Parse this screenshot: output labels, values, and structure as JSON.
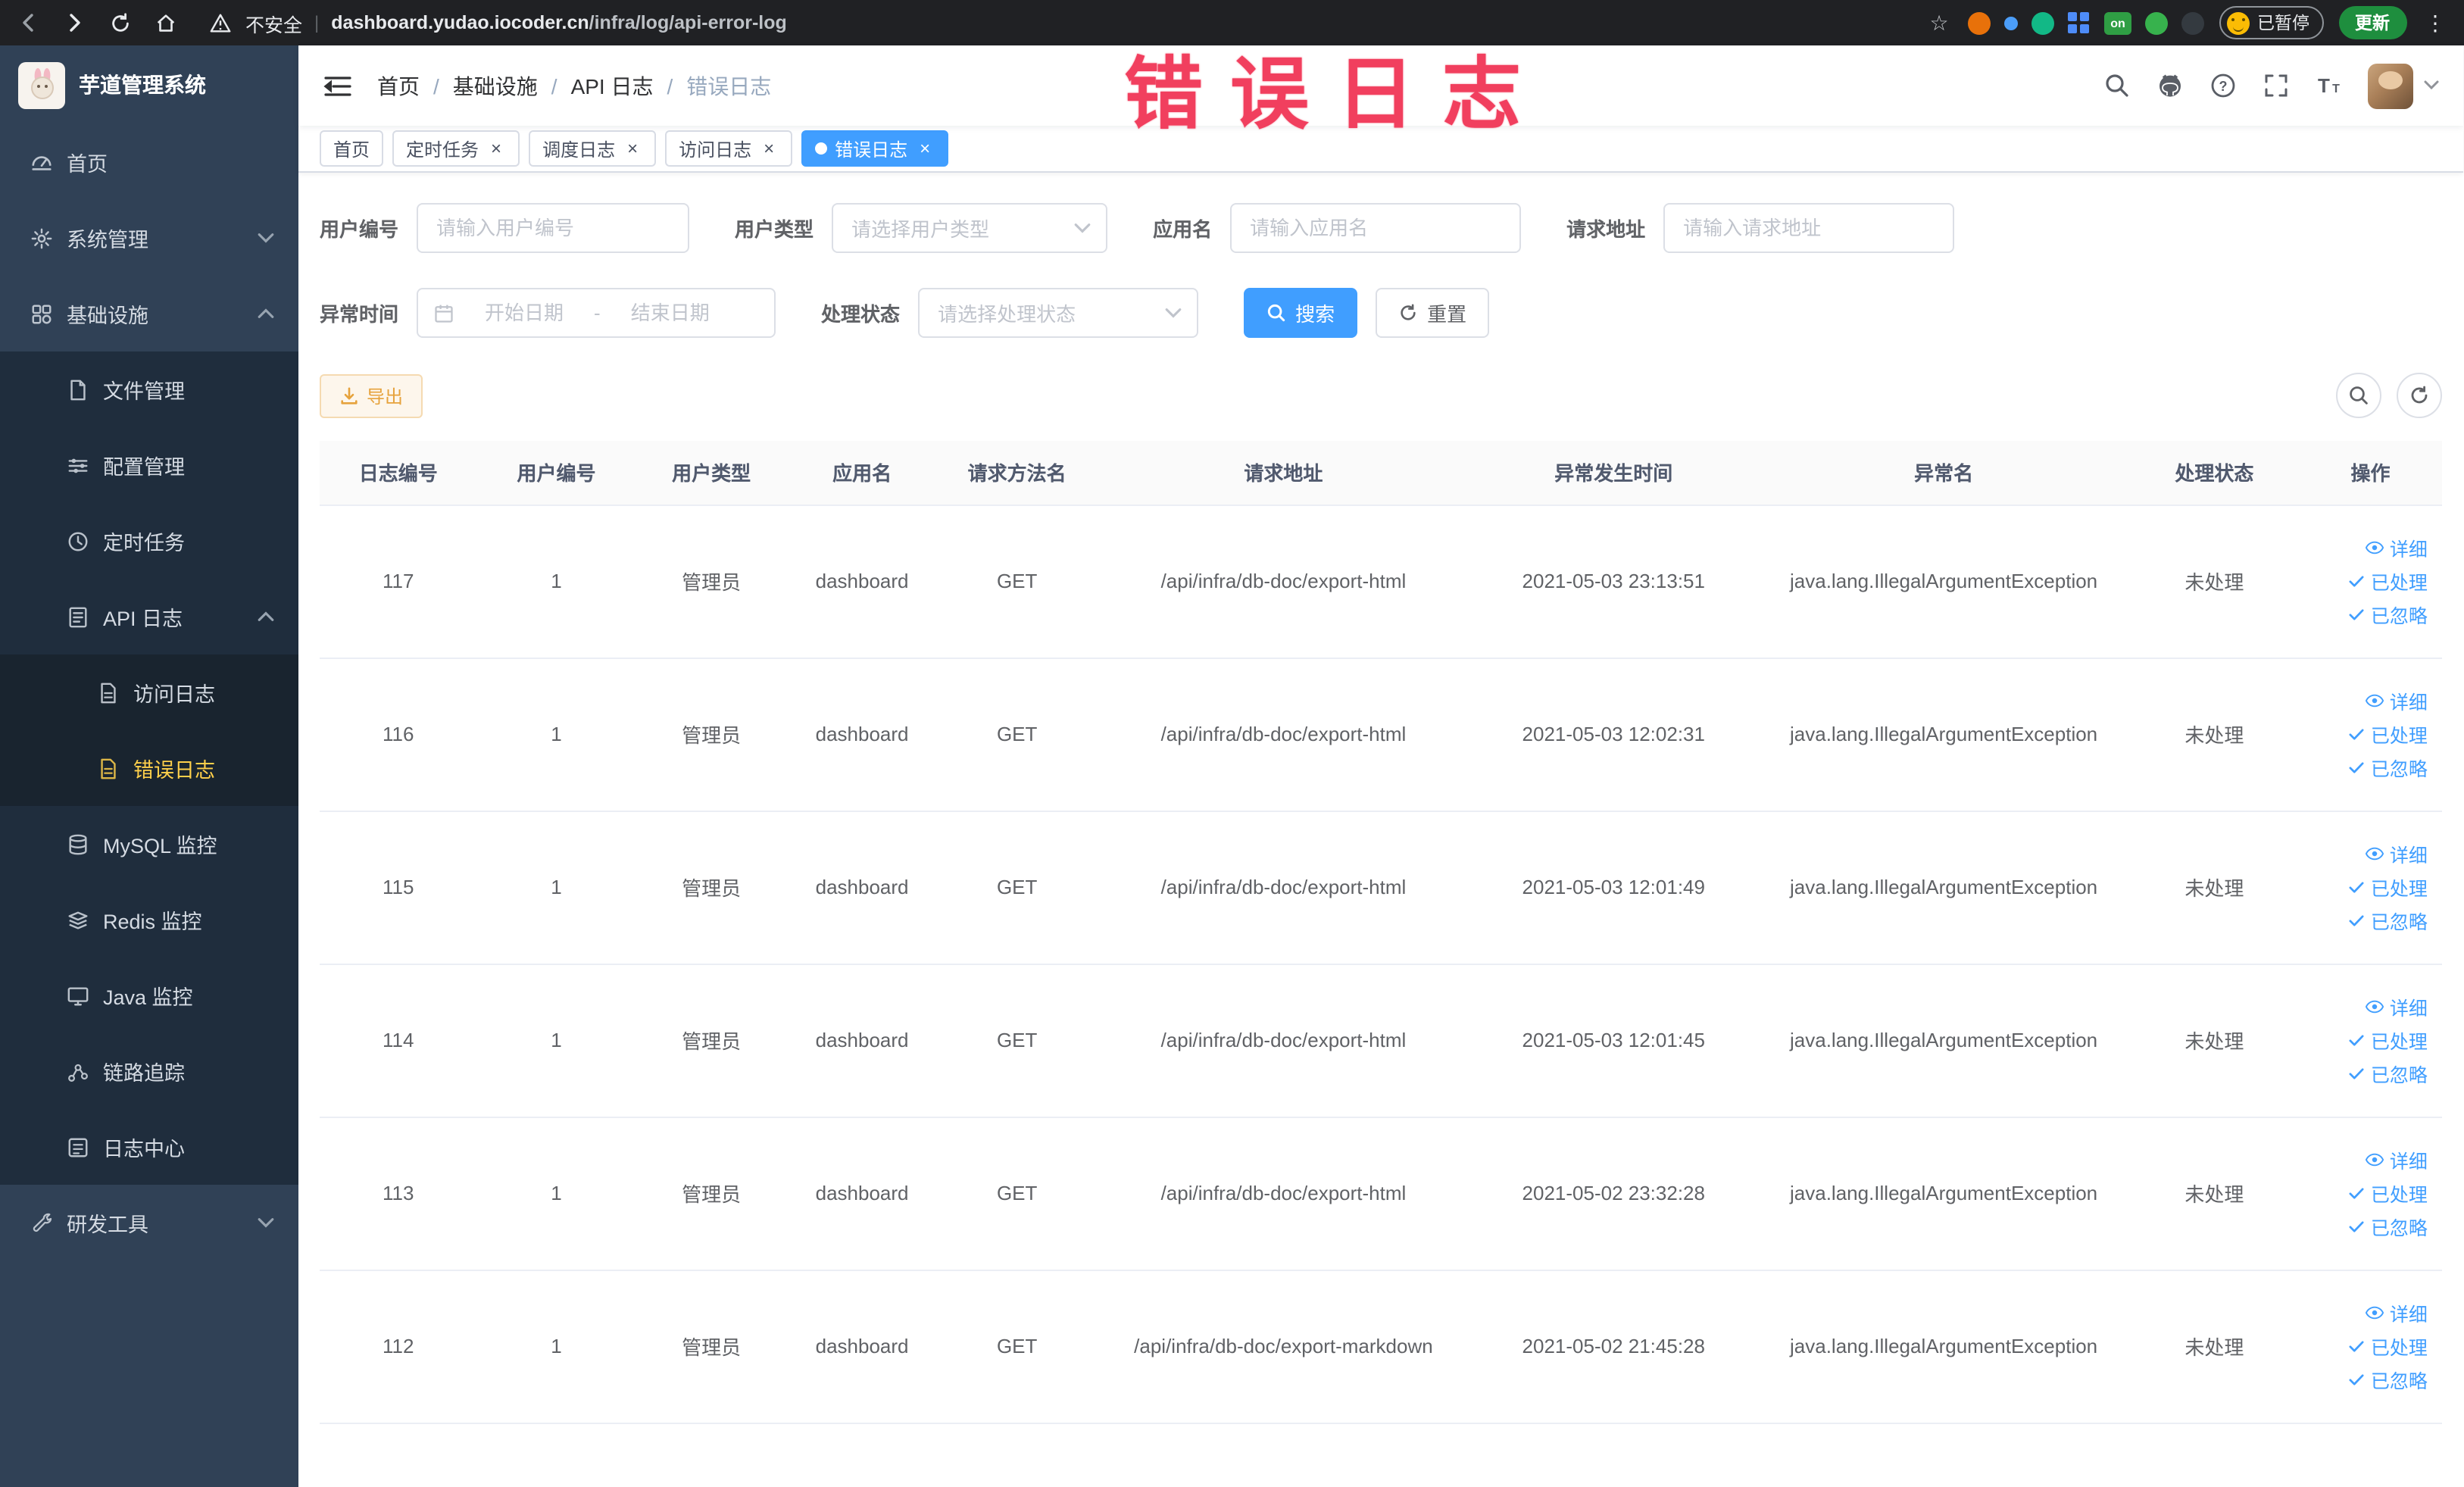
{
  "browser": {
    "security_label": "不安全",
    "url_domain": "dashboard.yudao.iocoder.cn",
    "url_path": "/infra/log/api-error-log",
    "paused_badge": "已暂停",
    "update_button": "更新",
    "extensions": [
      {
        "color": "#e8710a",
        "shape": "circle"
      },
      {
        "color": "#4b9df8",
        "shape": "dot"
      },
      {
        "color": "#12b886",
        "shape": "circle"
      },
      {
        "color": "#4e8cf7",
        "shape": "grid"
      },
      {
        "color": "#2f9e44",
        "shape": "badge",
        "label": "on"
      },
      {
        "color": "#37b24d",
        "shape": "circle"
      },
      {
        "color": "#343a40",
        "shape": "circle"
      }
    ]
  },
  "annotation": {
    "text": "错误日志",
    "color": "#f13f5e"
  },
  "sidebar": {
    "logo_title": "芋道管理系统",
    "items": [
      {
        "id": "home",
        "label": "首页",
        "level": 1,
        "icon": "home-icon"
      },
      {
        "id": "system",
        "label": "系统管理",
        "level": 1,
        "icon": "gear-icon",
        "chevron": "down"
      },
      {
        "id": "infra",
        "label": "基础设施",
        "level": 1,
        "icon": "infra-icon",
        "chevron": "up"
      },
      {
        "id": "file",
        "label": "文件管理",
        "level": 2,
        "icon": "file-icon"
      },
      {
        "id": "config",
        "label": "配置管理",
        "level": 2,
        "icon": "config-icon"
      },
      {
        "id": "task",
        "label": "定时任务",
        "level": 2,
        "icon": "task-icon"
      },
      {
        "id": "api-log",
        "label": "API 日志",
        "level": 2,
        "icon": "log-icon",
        "chevron": "up"
      },
      {
        "id": "access-log",
        "label": "访问日志",
        "level": 3,
        "icon": "doc-icon"
      },
      {
        "id": "error-log",
        "label": "错误日志",
        "level": 3,
        "icon": "doc-icon",
        "active": true
      },
      {
        "id": "mysql",
        "label": "MySQL 监控",
        "level": 2,
        "icon": "db-icon"
      },
      {
        "id": "redis",
        "label": "Redis 监控",
        "level": 2,
        "icon": "redis-icon"
      },
      {
        "id": "java",
        "label": "Java 监控",
        "level": 2,
        "icon": "monitor-icon"
      },
      {
        "id": "trace",
        "label": "链路追踪",
        "level": 2,
        "icon": "trace-icon"
      },
      {
        "id": "log-center",
        "label": "日志中心",
        "level": 2,
        "icon": "log-center-icon"
      },
      {
        "id": "dev-tools",
        "label": "研发工具",
        "level": 1,
        "icon": "tool-icon",
        "chevron": "down"
      }
    ]
  },
  "header": {
    "breadcrumb": [
      {
        "label": "首页"
      },
      {
        "label": "基础设施"
      },
      {
        "label": "API 日志"
      },
      {
        "label": "错误日志",
        "current": true
      }
    ]
  },
  "tabs": [
    {
      "id": "home",
      "label": "首页",
      "closable": false
    },
    {
      "id": "timed-task",
      "label": "定时任务",
      "closable": true
    },
    {
      "id": "schedule-log",
      "label": "调度日志",
      "closable": true
    },
    {
      "id": "access-log",
      "label": "访问日志",
      "closable": true
    },
    {
      "id": "error-log",
      "label": "错误日志",
      "closable": true,
      "active": true
    }
  ],
  "filters": {
    "user_id": {
      "label": "用户编号",
      "placeholder": "请输入用户编号"
    },
    "user_type": {
      "label": "用户类型",
      "placeholder": "请选择用户类型"
    },
    "app_name": {
      "label": "应用名",
      "placeholder": "请输入应用名"
    },
    "request_url": {
      "label": "请求地址",
      "placeholder": "请输入请求地址"
    },
    "exception_time": {
      "label": "异常时间",
      "start_placeholder": "开始日期",
      "separator": "-",
      "end_placeholder": "结束日期"
    },
    "process_status": {
      "label": "处理状态",
      "placeholder": "请选择处理状态"
    },
    "search_button": "搜索",
    "reset_button": "重置"
  },
  "toolbar": {
    "export_button": "导出"
  },
  "table": {
    "columns": [
      "日志编号",
      "用户编号",
      "用户类型",
      "应用名",
      "请求方法名",
      "请求地址",
      "异常发生时间",
      "异常名",
      "处理状态",
      "操作"
    ],
    "actions": [
      "详细",
      "已处理",
      "已忽略"
    ],
    "rows": [
      {
        "id": "117",
        "user_id": "1",
        "user_type": "管理员",
        "app_name": "dashboard",
        "method": "GET",
        "url": "/api/infra/db-doc/export-html",
        "time": "2021-05-03 23:13:51",
        "exception": "java.lang.IllegalArgumentException",
        "status": "未处理"
      },
      {
        "id": "116",
        "user_id": "1",
        "user_type": "管理员",
        "app_name": "dashboard",
        "method": "GET",
        "url": "/api/infra/db-doc/export-html",
        "time": "2021-05-03 12:02:31",
        "exception": "java.lang.IllegalArgumentException",
        "status": "未处理"
      },
      {
        "id": "115",
        "user_id": "1",
        "user_type": "管理员",
        "app_name": "dashboard",
        "method": "GET",
        "url": "/api/infra/db-doc/export-html",
        "time": "2021-05-03 12:01:49",
        "exception": "java.lang.IllegalArgumentException",
        "status": "未处理"
      },
      {
        "id": "114",
        "user_id": "1",
        "user_type": "管理员",
        "app_name": "dashboard",
        "method": "GET",
        "url": "/api/infra/db-doc/export-html",
        "time": "2021-05-03 12:01:45",
        "exception": "java.lang.IllegalArgumentException",
        "status": "未处理"
      },
      {
        "id": "113",
        "user_id": "1",
        "user_type": "管理员",
        "app_name": "dashboard",
        "method": "GET",
        "url": "/api/infra/db-doc/export-html",
        "time": "2021-05-02 23:32:28",
        "exception": "java.lang.IllegalArgumentException",
        "status": "未处理"
      },
      {
        "id": "112",
        "user_id": "1",
        "user_type": "管理员",
        "app_name": "dashboard",
        "method": "GET",
        "url": "/api/infra/db-doc/export-markdown",
        "time": "2021-05-02 21:45:28",
        "exception": "java.lang.IllegalArgumentException",
        "status": "未处理"
      }
    ]
  },
  "colors": {
    "accent": "#409eff",
    "sidebar_bg": "#304156",
    "submenu_bg": "#1f2d3d",
    "active_menu_text": "#ffd04b",
    "warning": "#e6a23c",
    "annotation_red": "#f13f5e"
  }
}
